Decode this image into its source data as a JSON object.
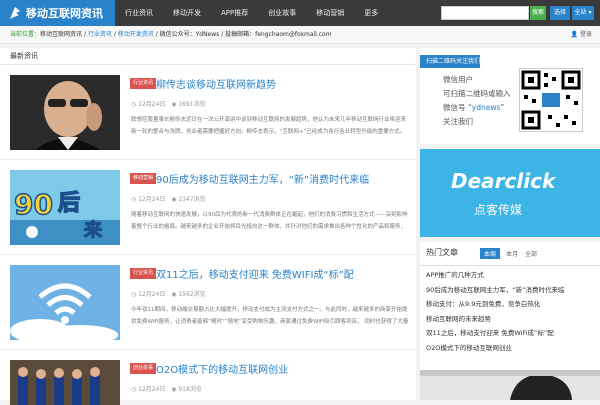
{
  "header": {
    "logo_text": "移动互联网资讯",
    "nav": [
      "行业资讯",
      "移动开发",
      "APP推荐",
      "创业故事",
      "移动营销",
      "更多"
    ],
    "search_placeholder": "",
    "search_button": "搜索",
    "select_button": "选择",
    "select2_button": "全站 ▾"
  },
  "crumbbar": {
    "prefix": "当前位置：",
    "home": "移动互联网资讯",
    "sep1": " / ",
    "link1": "行业资讯",
    "sep2": " / ",
    "link2": "移动开发资讯",
    "sep3": " / ",
    "wechat": "微信公众号：YdNews",
    "sep4": " / ",
    "email": "投稿邮箱：fengchaom@foxmail.com",
    "login": "登录"
  },
  "main": {
    "heading": "最新资讯",
    "articles": [
      {
        "tag": "行业资讯",
        "title": "柳传志谈移动互联网新趋势",
        "date": "12月24日",
        "views": "1691浏览",
        "excerpt": "联想控股董事长柳传志近日在一次公开演讲中谈到移动互联网的发展趋势，他认为未来几年移动互联网行业将迎来新一轮的整合与洗牌，创业者需要把握好方向。柳传志表示，“互联网+”已经成为各行各业转型升级的重要方式。据悉11月24日，他在第10届中国企业领袖年会上发表了主题演讲..."
      },
      {
        "tag": "移动营销",
        "title": "90后成为移动互联网主力军，“新”消费时代来临",
        "date": "12月24日",
        "views": "2347浏览",
        "excerpt": "随着移动互联网的快速发展，以90后为代表的新一代消费群体正在崛起，他们的消费习惯和生活方式——深刻影响着整个行业的格局。越来越多的企业开始将目光投向这一群体，并针对他们的需求推出各种个性化的产品和服务，以期在激烈的市场竞争中抢占先机 ..."
      },
      {
        "tag": "行业资讯",
        "title": "双11之后，移动支付迎来 免费WIFI成“标”配",
        "date": "12月24日",
        "views": "1562浏览",
        "excerpt": "今年双11期间，移动端交易额占比大幅提升，移动支付成为主流支付方式之一。与此同时，越来越多的商家开始提供免费WiFi服务，让消费者能够“随时”“随地”享受购物乐趣。商家通过免费WiFi吸引顾客到店，  同时也获得了大量的用户数据，双11过后，各大电商平台纷纷推出新的营销策略..."
      },
      {
        "tag": "创业故事",
        "title": "O2O模式下的移动互联网创业",
        "date": "12月24日",
        "views": "918浏览",
        "excerpt": ""
      }
    ]
  },
  "side": {
    "wechat_head": "扫描二维码关注我们",
    "wechat_line1": "微信用户",
    "wechat_line2": "可扫描二维码或输入",
    "wechat_line3_prefix": "微信号 “",
    "wechat_id": "ydnews",
    "wechat_line3_suffix": "”",
    "wechat_line4": "关注我们",
    "banner_title": "Dearclick",
    "banner_sub": "点客传媒",
    "hot_title": "热门文章",
    "hot_tabs": [
      "本周",
      "本月",
      "全部"
    ],
    "hot_items": [
      "APP推广的几种方式",
      "90后成为移动互联网主力军，“新”消费时代来临",
      "移动支付：从9.9元到免费，竞争白热化",
      "移动互联网的未来趋势",
      "双11之后，移动支付迎来 免费WiFi成“标”配",
      "O2O模式下的移动互联网创业"
    ]
  },
  "colors": {
    "brand_blue": "#2a82c9",
    "tag_red": "#d9534f",
    "search_green": "#4cae4c",
    "banner_blue": "#3cb4e6"
  }
}
